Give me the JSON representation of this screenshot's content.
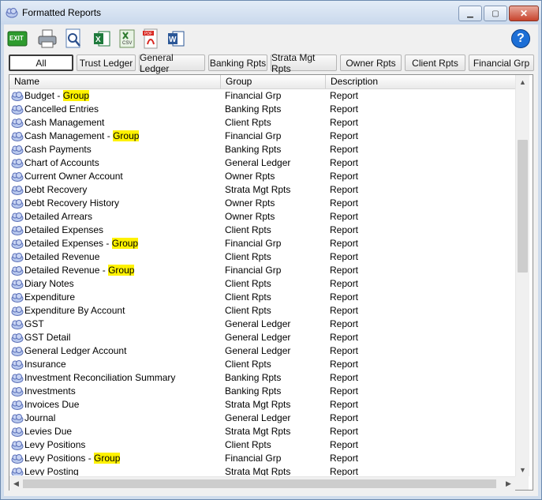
{
  "window": {
    "title": "Formatted Reports"
  },
  "toolbar": {
    "exit_label": "EXIT",
    "csv_label": "CSV",
    "pdf_label": "PDF",
    "help_label": "?"
  },
  "tabs": [
    "All",
    "Trust Ledger",
    "General Ledger",
    "Banking Rpts",
    "Strata Mgt Rpts",
    "Owner Rpts",
    "Client Rpts",
    "Financial Grp"
  ],
  "columns": {
    "name": "Name",
    "group": "Group",
    "description": "Description"
  },
  "rows": [
    {
      "name": "Budget - ",
      "hl": "Group",
      "group": "Financial Grp",
      "desc": "Report"
    },
    {
      "name": "Cancelled Entries",
      "hl": "",
      "group": "Banking Rpts",
      "desc": "Report"
    },
    {
      "name": "Cash Management",
      "hl": "",
      "group": "Client Rpts",
      "desc": "Report"
    },
    {
      "name": "Cash Management - ",
      "hl": "Group",
      "group": "Financial Grp",
      "desc": "Report"
    },
    {
      "name": "Cash Payments",
      "hl": "",
      "group": "Banking Rpts",
      "desc": "Report"
    },
    {
      "name": "Chart of Accounts",
      "hl": "",
      "group": "General Ledger",
      "desc": "Report"
    },
    {
      "name": "Current Owner Account",
      "hl": "",
      "group": "Owner Rpts",
      "desc": "Report"
    },
    {
      "name": "Debt Recovery",
      "hl": "",
      "group": "Strata Mgt Rpts",
      "desc": "Report"
    },
    {
      "name": "Debt Recovery History",
      "hl": "",
      "group": "Owner Rpts",
      "desc": "Report"
    },
    {
      "name": "Detailed Arrears",
      "hl": "",
      "group": "Owner Rpts",
      "desc": "Report"
    },
    {
      "name": "Detailed Expenses",
      "hl": "",
      "group": "Client Rpts",
      "desc": "Report"
    },
    {
      "name": "Detailed Expenses - ",
      "hl": "Group",
      "group": "Financial Grp",
      "desc": "Report"
    },
    {
      "name": "Detailed Revenue",
      "hl": "",
      "group": "Client Rpts",
      "desc": "Report"
    },
    {
      "name": "Detailed Revenue - ",
      "hl": "Group",
      "group": "Financial Grp",
      "desc": "Report"
    },
    {
      "name": "Diary Notes",
      "hl": "",
      "group": "Client Rpts",
      "desc": "Report"
    },
    {
      "name": "Expenditure",
      "hl": "",
      "group": "Client Rpts",
      "desc": "Report"
    },
    {
      "name": "Expenditure By Account",
      "hl": "",
      "group": "Client Rpts",
      "desc": "Report"
    },
    {
      "name": "GST",
      "hl": "",
      "group": "General Ledger",
      "desc": "Report"
    },
    {
      "name": "GST Detail",
      "hl": "",
      "group": "General Ledger",
      "desc": "Report"
    },
    {
      "name": "General Ledger Account",
      "hl": "",
      "group": "General Ledger",
      "desc": "Report"
    },
    {
      "name": "Insurance",
      "hl": "",
      "group": "Client Rpts",
      "desc": "Report"
    },
    {
      "name": "Investment Reconciliation Summary",
      "hl": "",
      "group": "Banking Rpts",
      "desc": "Report"
    },
    {
      "name": "Investments",
      "hl": "",
      "group": "Banking Rpts",
      "desc": "Report"
    },
    {
      "name": "Invoices Due",
      "hl": "",
      "group": "Strata Mgt Rpts",
      "desc": "Report"
    },
    {
      "name": "Journal",
      "hl": "",
      "group": "General Ledger",
      "desc": "Report"
    },
    {
      "name": "Levies Due",
      "hl": "",
      "group": "Strata Mgt Rpts",
      "desc": "Report"
    },
    {
      "name": "Levy Positions",
      "hl": "",
      "group": "Client Rpts",
      "desc": "Report"
    },
    {
      "name": "Levy Positions - ",
      "hl": "Group",
      "group": "Financial Grp",
      "desc": "Report"
    },
    {
      "name": "Levy Posting",
      "hl": "",
      "group": "Strata Mgt Rpts",
      "desc": "Report"
    }
  ],
  "icons": {
    "app": "report-cloud-icon",
    "exit": "exit-icon",
    "print": "printer-icon",
    "preview": "print-preview-icon",
    "excel": "excel-icon",
    "csv": "csv-icon",
    "pdf": "pdf-icon",
    "word": "word-icon",
    "help": "help-icon",
    "row": "report-cloud-icon",
    "scroll_up": "chevron-up-icon",
    "scroll_down": "chevron-down-icon",
    "scroll_left": "chevron-left-icon",
    "scroll_right": "chevron-right-icon"
  },
  "colors": {
    "highlight": "#fff200",
    "exit_green": "#2e9b2e",
    "excel_green": "#1e7a3c",
    "pdf_red": "#d8261f",
    "word_blue": "#2b5797",
    "help_blue": "#1d6fd6"
  }
}
